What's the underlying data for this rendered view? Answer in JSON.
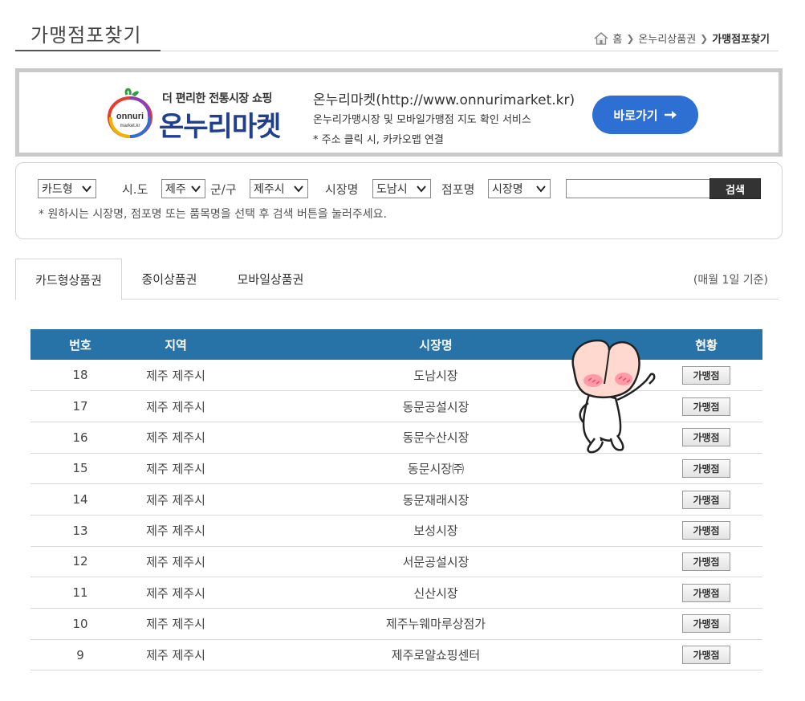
{
  "header": {
    "title": "가맹점포찾기",
    "breadcrumb": {
      "home": "홈",
      "section": "온누리상품권",
      "current": "가맹점포찾기"
    }
  },
  "banner": {
    "logo_text": "onnuri",
    "logo_sub": "market.kr",
    "tagline": "더 편리한 전통시장 쇼핑",
    "brand": "온누리마켓",
    "site": "온누리마켓(http://www.onnurimarket.kr)",
    "description": "온누리가맹시장 및 모바일가맹점 지도 확인 서비스",
    "note": "* 주소 클릭 시, 카카오맵 연결",
    "button_label": "바로가기",
    "button_color": "#2e6fd4"
  },
  "search": {
    "type_select": "카드형",
    "sido_label": "시.도",
    "sido_select": "제주",
    "gungu_label": "군/구",
    "gungu_select": "제주시",
    "market_label": "시장명",
    "market_select": "도남시",
    "store_label": "점포명",
    "store_select": "시장명",
    "keyword_value": "",
    "button_label": "검색",
    "hint": "* 원하시는 시장명, 점포명 또는 품목명을 선택 후 검색 버튼을 눌러주세요."
  },
  "tabs": {
    "items": [
      {
        "label": "카드형상품권",
        "active": true
      },
      {
        "label": "종이상품권",
        "active": false
      },
      {
        "label": "모바일상품권",
        "active": false
      }
    ],
    "note": "(매월 1일 기준)"
  },
  "table": {
    "header_color": "#2773a8",
    "columns": [
      "번호",
      "지역",
      "시장명",
      "현황"
    ],
    "rows": [
      {
        "no": "18",
        "region": "제주 제주시",
        "market": "도남시장",
        "status": "가맹점"
      },
      {
        "no": "17",
        "region": "제주 제주시",
        "market": "동문공설시장",
        "status": "가맹점"
      },
      {
        "no": "16",
        "region": "제주 제주시",
        "market": "동문수산시장",
        "status": "가맹점"
      },
      {
        "no": "15",
        "region": "제주 제주시",
        "market": "동문시장㈜",
        "status": "가맹점"
      },
      {
        "no": "14",
        "region": "제주 제주시",
        "market": "동문재래시장",
        "status": "가맹점"
      },
      {
        "no": "13",
        "region": "제주 제주시",
        "market": "보성시장",
        "status": "가맹점"
      },
      {
        "no": "12",
        "region": "제주 제주시",
        "market": "서문공설시장",
        "status": "가맹점"
      },
      {
        "no": "11",
        "region": "제주 제주시",
        "market": "신산시장",
        "status": "가맹점"
      },
      {
        "no": "10",
        "region": "제주 제주시",
        "market": "제주누웨마루상점가",
        "status": "가맹점"
      },
      {
        "no": "9",
        "region": "제주 제주시",
        "market": "제주로얄쇼핑센터",
        "status": "가맹점"
      }
    ]
  },
  "mascot": {
    "icon": "peach-character-icon"
  }
}
